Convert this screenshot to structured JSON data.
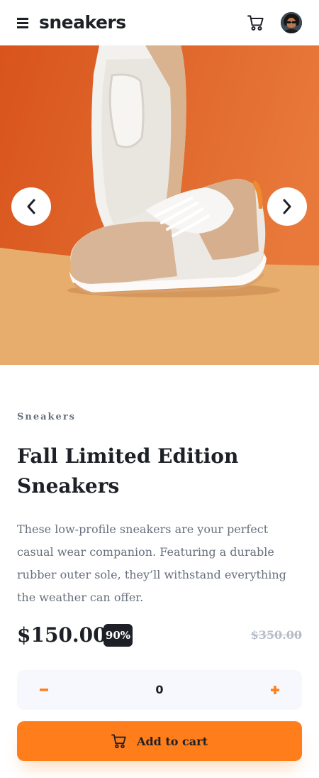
{
  "header": {
    "logo": "sneakers",
    "menu_icon": "hamburger-icon",
    "cart_icon": "cart-icon",
    "avatar": "user-avatar"
  },
  "gallery": {
    "prev_icon": "chevron-left-icon",
    "next_icon": "chevron-right-icon",
    "colors": {
      "background": "#e2632a",
      "floor": "#e7ad6c"
    }
  },
  "product": {
    "category": "Sneakers",
    "title": "Fall Limited Edition Sneakers",
    "description": "These low-profile sneakers are your perfect casual wear companion. Featuring a durable rubber outer sole, they’ll withstand everything the weather can offer.",
    "price": "$150.00",
    "discount": "90%",
    "old_price": "$350.00"
  },
  "quantity": {
    "value": "0",
    "minus_icon": "minus-icon",
    "plus_icon": "plus-icon"
  },
  "add_to_cart": {
    "label": "Add to cart",
    "icon": "cart-icon"
  },
  "colors": {
    "accent": "#ff7e1b",
    "dark": "#1d2026",
    "muted": "#68707d",
    "light_bg": "#f6f8fd"
  }
}
